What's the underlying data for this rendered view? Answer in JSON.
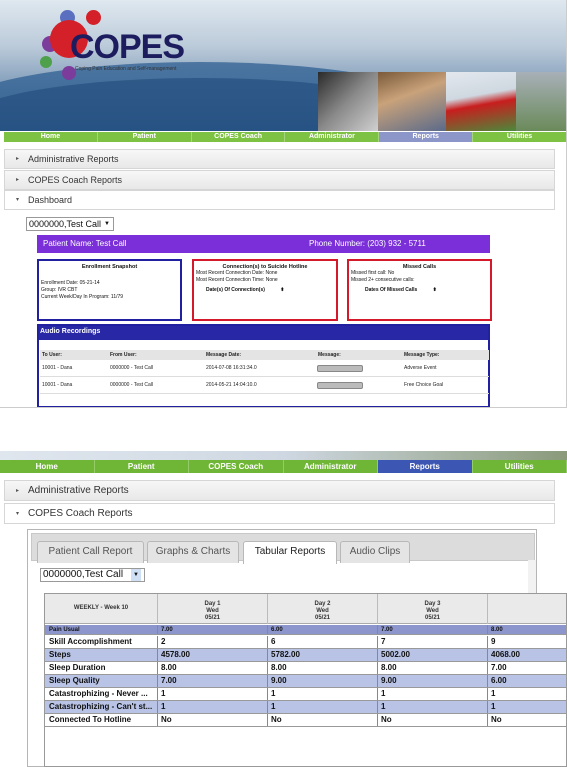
{
  "logo": {
    "title": "COPES",
    "subtitle": "Coping Pain Education and Self-management"
  },
  "nav_items": [
    "Home",
    "Patient",
    "COPES Coach",
    "Administrator",
    "Reports",
    "Utilities"
  ],
  "active_nav": "Reports",
  "accordion": {
    "admin": "Administrative Reports",
    "coach": "COPES Coach Reports",
    "dashboard": "Dashboard"
  },
  "patient_select": "0000000,Test Call",
  "patient_bar": {
    "name_label": "Patient Name: Test Call",
    "phone_label": "Phone Number: (203) 932 - 5711"
  },
  "enrollment": {
    "title": "Enrollment Snapshot",
    "date": "Enrollment Date: 05-21-14",
    "group": "Group: IVR CBT",
    "week": "Current Week/Day In Program: 11/79"
  },
  "hotline": {
    "title": "Connection(s) to Suicide Hotline",
    "recent_date": "Most Recent Connection Date: None",
    "recent_time": "Most Recent Connection Time: None",
    "select_label": "Date(s) Of Connection(s)"
  },
  "missed": {
    "title": "Missed Calls",
    "first": "Missed first call: No",
    "consecutive": "Missed 2+ consecutive calls:",
    "select_label": "Dates Of Missed Calls"
  },
  "audio": {
    "title": "Audio Recordings",
    "headers": [
      "To User:",
      "From User:",
      "Message Date:",
      "Message:",
      "Message Type:"
    ],
    "rows": [
      [
        "10001 - Dana",
        "0000000 - Test Call",
        "2014-07-08 16:31:34.0",
        "Adverse Event"
      ],
      [
        "10001 - Dana",
        "0000000 - Test Call",
        "2014-05-21 14:04:10.0",
        "Free Choice Goal"
      ]
    ]
  },
  "tabs": [
    "Patient Call Report",
    "Graphs & Charts",
    "Tabular Reports",
    "Audio Clips"
  ],
  "active_tab": "Tabular Reports",
  "tabular": {
    "week_label": "WEEKLY - Week 10",
    "days": [
      {
        "d": "Day 1",
        "w": "Wed",
        "dt": "05/21"
      },
      {
        "d": "Day 2",
        "w": "Wed",
        "dt": "05/21"
      },
      {
        "d": "Day 3",
        "w": "Wed",
        "dt": "05/21"
      }
    ],
    "rows": [
      {
        "label": "Pain Usual",
        "values": [
          "7.00",
          "6.00",
          "7.00",
          "8.00"
        ]
      },
      {
        "label": "Skill Accomplishment",
        "values": [
          "2",
          "6",
          "7",
          "9"
        ]
      },
      {
        "label": "Steps",
        "values": [
          "4578.00",
          "5782.00",
          "5002.00",
          "4068.00"
        ]
      },
      {
        "label": "Sleep Duration",
        "values": [
          "8.00",
          "8.00",
          "8.00",
          "7.00"
        ]
      },
      {
        "label": "Sleep Quality",
        "values": [
          "7.00",
          "9.00",
          "9.00",
          "6.00"
        ]
      },
      {
        "label": "Catastrophizing - Never ...",
        "values": [
          "1",
          "1",
          "1",
          "1"
        ]
      },
      {
        "label": "Catastrophizing - Can't st...",
        "values": [
          "1",
          "1",
          "1",
          "1"
        ]
      },
      {
        "label": "Connected To Hotline",
        "values": [
          "No",
          "No",
          "No",
          "No"
        ]
      }
    ]
  }
}
